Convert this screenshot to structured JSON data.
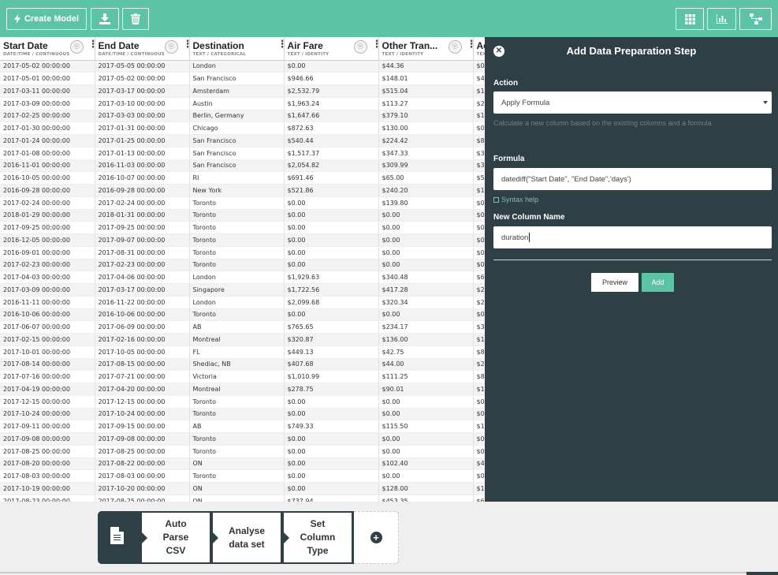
{
  "toolbar": {
    "create_model_label": "Create Model",
    "colors": {
      "bar": "#5cc4a5",
      "panel": "#2e3f45"
    }
  },
  "table": {
    "columns": [
      {
        "title": "Start Date",
        "subtitle": "DATE/TIME / CONTINUOUS",
        "has_bulb": true
      },
      {
        "title": "End Date",
        "subtitle": "DATE/TIME / CONTINUOUS",
        "has_bulb": true
      },
      {
        "title": "Destination",
        "subtitle": "TEXT / CATEGORICAL",
        "has_bulb": false
      },
      {
        "title": "Air Fare",
        "subtitle": "TEXT / IDENTITY",
        "has_bulb": true
      },
      {
        "title": "Other Tran...",
        "subtitle": "TEXT / IDENTITY",
        "has_bulb": true
      },
      {
        "title": "Ac",
        "subtitle": "TEXT / IDENTITY",
        "has_bulb": false
      }
    ],
    "rows": [
      [
        "2017-05-02 00:00:00",
        "2017-05-05 00:00:00",
        "London",
        "$0.00",
        "$44.36",
        "$0"
      ],
      [
        "2017-05-01 00:00:00",
        "2017-05-02 00:00:00",
        "San Francisco",
        "$946.66",
        "$148.01",
        "$4"
      ],
      [
        "2017-03-11 00:00:00",
        "2017-03-17 00:00:00",
        "Amsterdam",
        "$2,532.79",
        "$515.04",
        "$1"
      ],
      [
        "2017-03-09 00:00:00",
        "2017-03-10 00:00:00",
        "Austin",
        "$1,963.24",
        "$113.27",
        "$2"
      ],
      [
        "2017-02-25 00:00:00",
        "2017-03-03 00:00:00",
        "Berlin, Germany",
        "$1,647.66",
        "$379.10",
        "$1"
      ],
      [
        "2017-01-30 00:00:00",
        "2017-01-31 00:00:00",
        "Chicago",
        "$872.63",
        "$130.00",
        "$0"
      ],
      [
        "2017-01-24 00:00:00",
        "2017-01-25 00:00:00",
        "San Francisco",
        "$540.44",
        "$224.42",
        "$8"
      ],
      [
        "2017-01-08 00:00:00",
        "2017-01-13 00:00:00",
        "San Francisco",
        "$1,517.37",
        "$347.33",
        "$3"
      ],
      [
        "2016-11-01 00:00:00",
        "2016-11-03 00:00:00",
        "San Francisco",
        "$2,054.82",
        "$309.99",
        "$3"
      ],
      [
        "2016-10-05 00:00:00",
        "2016-10-07 00:00:00",
        "RI",
        "$691.46",
        "$65.00",
        "$5"
      ],
      [
        "2016-09-28 00:00:00",
        "2016-09-28 00:00:00",
        "New York",
        "$521.86",
        "$240.20",
        "$1"
      ],
      [
        "2017-02-24 00:00:00",
        "2017-02-24 00:00:00",
        "Toronto",
        "$0.00",
        "$139.80",
        "$0"
      ],
      [
        "2018-01-29 00:00:00",
        "2018-01-31 00:00:00",
        "Toronto",
        "$0.00",
        "$0.00",
        "$0"
      ],
      [
        "2017-09-25 00:00:00",
        "2017-09-25 00:00:00",
        "Toronto",
        "$0.00",
        "$0.00",
        "$0"
      ],
      [
        "2016-12-05 00:00:00",
        "2017-09-07 00:00:00",
        "Toronto",
        "$0.00",
        "$0.00",
        "$0"
      ],
      [
        "2016-09-01 00:00:00",
        "2017-08-31 00:00:00",
        "Toronto",
        "$0.00",
        "$0.00",
        "$0"
      ],
      [
        "2017-02-23 00:00:00",
        "2017-02-23 00:00:00",
        "Toronto",
        "$0.00",
        "$0.00",
        "$0"
      ],
      [
        "2017-04-03 00:00:00",
        "2017-04-06 00:00:00",
        "London",
        "$1,929.63",
        "$340.48",
        "$6"
      ],
      [
        "2017-03-09 00:00:00",
        "2017-03-17 00:00:00",
        "Singapore",
        "$1,722.56",
        "$417.28",
        "$2"
      ],
      [
        "2016-11-11 00:00:00",
        "2016-11-22 00:00:00",
        "London",
        "$2,099.68",
        "$320.34",
        "$2"
      ],
      [
        "2016-10-06 00:00:00",
        "2016-10-06 00:00:00",
        "Toronto",
        "$0.00",
        "$0.00",
        "$0"
      ],
      [
        "2017-06-07 00:00:00",
        "2017-06-09 00:00:00",
        "AB",
        "$765.65",
        "$234.17",
        "$3"
      ],
      [
        "2017-02-15 00:00:00",
        "2017-02-16 00:00:00",
        "Montreal",
        "$320.87",
        "$136.00",
        "$1"
      ],
      [
        "2017-10-01 00:00:00",
        "2017-10-05 00:00:00",
        "FL",
        "$449.13",
        "$42.75",
        "$8"
      ],
      [
        "2017-08-14 00:00:00",
        "2017-08-15 00:00:00",
        "Shediac, NB",
        "$407.68",
        "$44.00",
        "$2"
      ],
      [
        "2017-07-16 00:00:00",
        "2017-07-21 00:00:00",
        "Victoria",
        "$1,010.99",
        "$111.25",
        "$8"
      ],
      [
        "2017-04-19 00:00:00",
        "2017-04-20 00:00:00",
        "Montreal",
        "$278.75",
        "$90.01",
        "$1"
      ],
      [
        "2017-12-15 00:00:00",
        "2017-12-15 00:00:00",
        "Toronto",
        "$0.00",
        "$0.00",
        "$0"
      ],
      [
        "2017-10-24 00:00:00",
        "2017-10-24 00:00:00",
        "Toronto",
        "$0.00",
        "$0.00",
        "$0"
      ],
      [
        "2017-09-11 00:00:00",
        "2017-09-15 00:00:00",
        "AB",
        "$749.33",
        "$115.50",
        "$1"
      ],
      [
        "2017-09-08 00:00:00",
        "2017-09-08 00:00:00",
        "Toronto",
        "$0.00",
        "$0.00",
        "$0"
      ],
      [
        "2017-08-25 00:00:00",
        "2017-08-25 00:00:00",
        "Toronto",
        "$0.00",
        "$0.00",
        "$0"
      ],
      [
        "2017-08-20 00:00:00",
        "2017-08-22 00:00:00",
        "ON",
        "$0.00",
        "$102.40",
        "$4"
      ],
      [
        "2017-08-03 00:00:00",
        "2017-08-03 00:00:00",
        "Toronto",
        "$0.00",
        "$0.00",
        "$0"
      ],
      [
        "2017-10-19 00:00:00",
        "2017-10-20 00:00:00",
        "ON",
        "$0.00",
        "$128.00",
        "$1"
      ],
      [
        "2017-08-23 00:00:00",
        "2017-08-25 00:00:00",
        "ON",
        "$737.94",
        "$453.35",
        "$6"
      ]
    ]
  },
  "panel": {
    "title": "Add Data Preparation Step",
    "action_label": "Action",
    "action_value": "Apply Formula",
    "action_help": "Calculate a new column based on the existing columns and a formula",
    "formula_label": "Formula",
    "formula_value": "datediff(\"Start Date\", \"End Date\",'days')",
    "syntax_help": "Syntax help",
    "new_column_label": "New Column Name",
    "new_column_value": "duration",
    "preview_label": "Preview",
    "add_label": "Add"
  },
  "pipeline": {
    "steps": [
      {
        "label": "Auto Parse CSV"
      },
      {
        "label": "Analyse data set"
      },
      {
        "label": "Set Column Type"
      }
    ]
  }
}
